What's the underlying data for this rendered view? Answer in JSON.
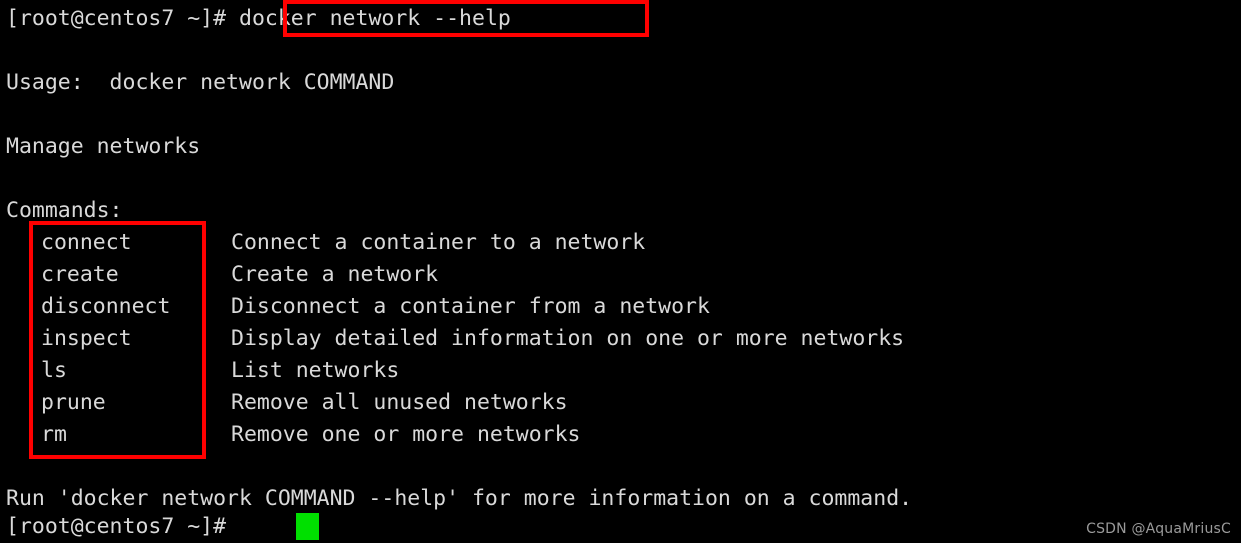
{
  "terminal": {
    "background_color": "#000000",
    "text_color": "#d9d9d9",
    "cursor_color": "#00e000",
    "highlight_color": "#ff0000",
    "prompt": "[root@centos7 ~]#",
    "typed_command": " docker network --help",
    "usage_line": "Usage:  docker network COMMAND",
    "description_line": "Manage networks",
    "commands_heading": "Commands:",
    "commands": [
      {
        "name": "connect",
        "description": "Connect a container to a network"
      },
      {
        "name": "create",
        "description": "Create a network"
      },
      {
        "name": "disconnect",
        "description": "Disconnect a container from a network"
      },
      {
        "name": "inspect",
        "description": "Display detailed information on one or more networks"
      },
      {
        "name": "ls",
        "description": "List networks"
      },
      {
        "name": "prune",
        "description": "Remove all unused networks"
      },
      {
        "name": "rm",
        "description": "Remove one or more networks"
      }
    ],
    "footer_line": "Run 'docker network COMMAND --help' for more information on a command.",
    "final_prompt": "[root@centos7 ~]# ",
    "watermark": "CSDN @AquaMriusC"
  }
}
